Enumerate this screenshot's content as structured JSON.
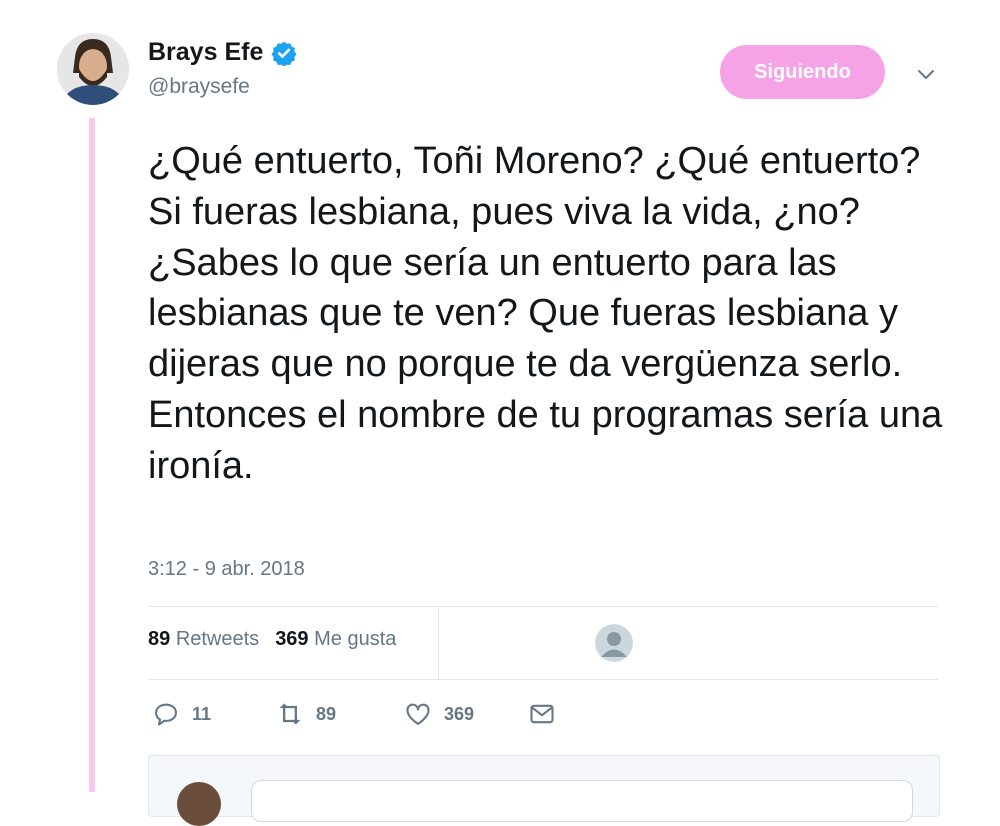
{
  "author": {
    "name": "Brays Efe",
    "handle": "@braysefe",
    "verified_icon": "verified-badge-icon",
    "follow_button": "Siguiendo"
  },
  "tweet": {
    "text": "¿Qué entuerto, Toñi Moreno? ¿Qué entuerto? Si fueras lesbiana, pues viva la vida, ¿no?\n¿Sabes lo que sería un entuerto para las lesbianas que te ven? Que fueras lesbiana y dijeras que no porque te da vergüenza serlo. Entonces el nombre de tu programas sería una ironía.",
    "timestamp": "3:12 - 9 abr. 2018"
  },
  "stats": {
    "retweets_count": "89",
    "retweets_label": "Retweets",
    "likes_count": "369",
    "likes_label": "Me gusta"
  },
  "actions": {
    "replies": "11",
    "retweets": "89",
    "likes": "369"
  },
  "colors": {
    "accent_pink": "#f5a3e6",
    "thread_line": "#f7c8ee",
    "verified_blue": "#1da1f2",
    "muted_text": "#657786"
  }
}
